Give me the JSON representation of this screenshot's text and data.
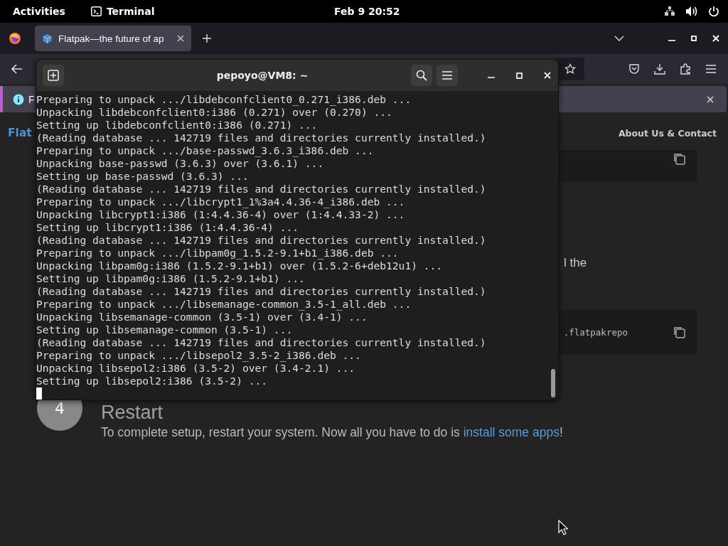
{
  "top_bar": {
    "activities": "Activities",
    "app": "Terminal",
    "clock": "Feb 9  20:52"
  },
  "browser": {
    "tabs": [
      {
        "title": "Flatpak—the future of ap",
        "selected": true
      }
    ],
    "notification": {
      "text": "F"
    },
    "page": {
      "logo": "Flat",
      "nav_link": "About Us & Contact",
      "command_fragment": ".flatpakrepo",
      "paragraph_fragment": "l the",
      "step": {
        "number": "4",
        "title": "Restart",
        "text_before": "To complete setup, restart your system. Now all you have to do is ",
        "link": "install some apps",
        "text_after": "!"
      }
    }
  },
  "terminal": {
    "title": "pepoyo@VM8: ~",
    "lines": [
      "Preparing to unpack .../libdebconfclient0_0.271_i386.deb ...",
      "Unpacking libdebconfclient0:i386 (0.271) over (0.270) ...",
      "Setting up libdebconfclient0:i386 (0.271) ...",
      "(Reading database ... 142719 files and directories currently installed.)",
      "Preparing to unpack .../base-passwd_3.6.3_i386.deb ...",
      "Unpacking base-passwd (3.6.3) over (3.6.1) ...",
      "Setting up base-passwd (3.6.3) ...",
      "(Reading database ... 142719 files and directories currently installed.)",
      "Preparing to unpack .../libcrypt1_1%3a4.4.36-4_i386.deb ...",
      "Unpacking libcrypt1:i386 (1:4.4.36-4) over (1:4.4.33-2) ...",
      "Setting up libcrypt1:i386 (1:4.4.36-4) ...",
      "(Reading database ... 142719 files and directories currently installed.)",
      "Preparing to unpack .../libpam0g_1.5.2-9.1+b1_i386.deb ...",
      "Unpacking libpam0g:i386 (1.5.2-9.1+b1) over (1.5.2-6+deb12u1) ...",
      "Setting up libpam0g:i386 (1.5.2-9.1+b1) ...",
      "(Reading database ... 142719 files and directories currently installed.)",
      "Preparing to unpack .../libsemanage-common_3.5-1_all.deb ...",
      "Unpacking libsemanage-common (3.5-1) over (3.4-1) ...",
      "Setting up libsemanage-common (3.5-1) ...",
      "(Reading database ... 142719 files and directories currently installed.)",
      "Preparing to unpack .../libsepol2_3.5-2_i386.deb ...",
      "Unpacking libsepol2:i386 (3.5-2) over (3.4-2.1) ...",
      "Setting up libsepol2:i386 (3.5-2) ..."
    ]
  }
}
